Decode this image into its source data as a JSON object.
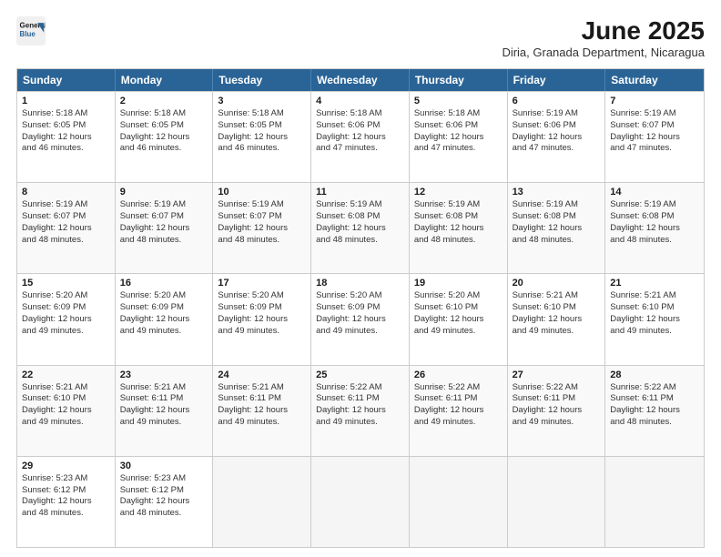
{
  "logo": {
    "line1": "General",
    "line2": "Blue"
  },
  "title": "June 2025",
  "subtitle": "Diria, Granada Department, Nicaragua",
  "header_days": [
    "Sunday",
    "Monday",
    "Tuesday",
    "Wednesday",
    "Thursday",
    "Friday",
    "Saturday"
  ],
  "weeks": [
    [
      {
        "day": "1",
        "rise": "Sunrise: 5:18 AM",
        "set": "Sunset: 6:05 PM",
        "dl1": "Daylight: 12 hours",
        "dl2": "and 46 minutes."
      },
      {
        "day": "2",
        "rise": "Sunrise: 5:18 AM",
        "set": "Sunset: 6:05 PM",
        "dl1": "Daylight: 12 hours",
        "dl2": "and 46 minutes."
      },
      {
        "day": "3",
        "rise": "Sunrise: 5:18 AM",
        "set": "Sunset: 6:05 PM",
        "dl1": "Daylight: 12 hours",
        "dl2": "and 46 minutes."
      },
      {
        "day": "4",
        "rise": "Sunrise: 5:18 AM",
        "set": "Sunset: 6:06 PM",
        "dl1": "Daylight: 12 hours",
        "dl2": "and 47 minutes."
      },
      {
        "day": "5",
        "rise": "Sunrise: 5:18 AM",
        "set": "Sunset: 6:06 PM",
        "dl1": "Daylight: 12 hours",
        "dl2": "and 47 minutes."
      },
      {
        "day": "6",
        "rise": "Sunrise: 5:19 AM",
        "set": "Sunset: 6:06 PM",
        "dl1": "Daylight: 12 hours",
        "dl2": "and 47 minutes."
      },
      {
        "day": "7",
        "rise": "Sunrise: 5:19 AM",
        "set": "Sunset: 6:07 PM",
        "dl1": "Daylight: 12 hours",
        "dl2": "and 47 minutes."
      }
    ],
    [
      {
        "day": "8",
        "rise": "Sunrise: 5:19 AM",
        "set": "Sunset: 6:07 PM",
        "dl1": "Daylight: 12 hours",
        "dl2": "and 48 minutes."
      },
      {
        "day": "9",
        "rise": "Sunrise: 5:19 AM",
        "set": "Sunset: 6:07 PM",
        "dl1": "Daylight: 12 hours",
        "dl2": "and 48 minutes."
      },
      {
        "day": "10",
        "rise": "Sunrise: 5:19 AM",
        "set": "Sunset: 6:07 PM",
        "dl1": "Daylight: 12 hours",
        "dl2": "and 48 minutes."
      },
      {
        "day": "11",
        "rise": "Sunrise: 5:19 AM",
        "set": "Sunset: 6:08 PM",
        "dl1": "Daylight: 12 hours",
        "dl2": "and 48 minutes."
      },
      {
        "day": "12",
        "rise": "Sunrise: 5:19 AM",
        "set": "Sunset: 6:08 PM",
        "dl1": "Daylight: 12 hours",
        "dl2": "and 48 minutes."
      },
      {
        "day": "13",
        "rise": "Sunrise: 5:19 AM",
        "set": "Sunset: 6:08 PM",
        "dl1": "Daylight: 12 hours",
        "dl2": "and 48 minutes."
      },
      {
        "day": "14",
        "rise": "Sunrise: 5:19 AM",
        "set": "Sunset: 6:08 PM",
        "dl1": "Daylight: 12 hours",
        "dl2": "and 48 minutes."
      }
    ],
    [
      {
        "day": "15",
        "rise": "Sunrise: 5:20 AM",
        "set": "Sunset: 6:09 PM",
        "dl1": "Daylight: 12 hours",
        "dl2": "and 49 minutes."
      },
      {
        "day": "16",
        "rise": "Sunrise: 5:20 AM",
        "set": "Sunset: 6:09 PM",
        "dl1": "Daylight: 12 hours",
        "dl2": "and 49 minutes."
      },
      {
        "day": "17",
        "rise": "Sunrise: 5:20 AM",
        "set": "Sunset: 6:09 PM",
        "dl1": "Daylight: 12 hours",
        "dl2": "and 49 minutes."
      },
      {
        "day": "18",
        "rise": "Sunrise: 5:20 AM",
        "set": "Sunset: 6:09 PM",
        "dl1": "Daylight: 12 hours",
        "dl2": "and 49 minutes."
      },
      {
        "day": "19",
        "rise": "Sunrise: 5:20 AM",
        "set": "Sunset: 6:10 PM",
        "dl1": "Daylight: 12 hours",
        "dl2": "and 49 minutes."
      },
      {
        "day": "20",
        "rise": "Sunrise: 5:21 AM",
        "set": "Sunset: 6:10 PM",
        "dl1": "Daylight: 12 hours",
        "dl2": "and 49 minutes."
      },
      {
        "day": "21",
        "rise": "Sunrise: 5:21 AM",
        "set": "Sunset: 6:10 PM",
        "dl1": "Daylight: 12 hours",
        "dl2": "and 49 minutes."
      }
    ],
    [
      {
        "day": "22",
        "rise": "Sunrise: 5:21 AM",
        "set": "Sunset: 6:10 PM",
        "dl1": "Daylight: 12 hours",
        "dl2": "and 49 minutes."
      },
      {
        "day": "23",
        "rise": "Sunrise: 5:21 AM",
        "set": "Sunset: 6:11 PM",
        "dl1": "Daylight: 12 hours",
        "dl2": "and 49 minutes."
      },
      {
        "day": "24",
        "rise": "Sunrise: 5:21 AM",
        "set": "Sunset: 6:11 PM",
        "dl1": "Daylight: 12 hours",
        "dl2": "and 49 minutes."
      },
      {
        "day": "25",
        "rise": "Sunrise: 5:22 AM",
        "set": "Sunset: 6:11 PM",
        "dl1": "Daylight: 12 hours",
        "dl2": "and 49 minutes."
      },
      {
        "day": "26",
        "rise": "Sunrise: 5:22 AM",
        "set": "Sunset: 6:11 PM",
        "dl1": "Daylight: 12 hours",
        "dl2": "and 49 minutes."
      },
      {
        "day": "27",
        "rise": "Sunrise: 5:22 AM",
        "set": "Sunset: 6:11 PM",
        "dl1": "Daylight: 12 hours",
        "dl2": "and 49 minutes."
      },
      {
        "day": "28",
        "rise": "Sunrise: 5:22 AM",
        "set": "Sunset: 6:11 PM",
        "dl1": "Daylight: 12 hours",
        "dl2": "and 48 minutes."
      }
    ],
    [
      {
        "day": "29",
        "rise": "Sunrise: 5:23 AM",
        "set": "Sunset: 6:12 PM",
        "dl1": "Daylight: 12 hours",
        "dl2": "and 48 minutes."
      },
      {
        "day": "30",
        "rise": "Sunrise: 5:23 AM",
        "set": "Sunset: 6:12 PM",
        "dl1": "Daylight: 12 hours",
        "dl2": "and 48 minutes."
      },
      {
        "day": "",
        "rise": "",
        "set": "",
        "dl1": "",
        "dl2": ""
      },
      {
        "day": "",
        "rise": "",
        "set": "",
        "dl1": "",
        "dl2": ""
      },
      {
        "day": "",
        "rise": "",
        "set": "",
        "dl1": "",
        "dl2": ""
      },
      {
        "day": "",
        "rise": "",
        "set": "",
        "dl1": "",
        "dl2": ""
      },
      {
        "day": "",
        "rise": "",
        "set": "",
        "dl1": "",
        "dl2": ""
      }
    ]
  ],
  "colors": {
    "header_bg": "#2a6496",
    "header_text": "#ffffff",
    "border": "#cccccc",
    "alt_row": "#f5f5f5"
  }
}
